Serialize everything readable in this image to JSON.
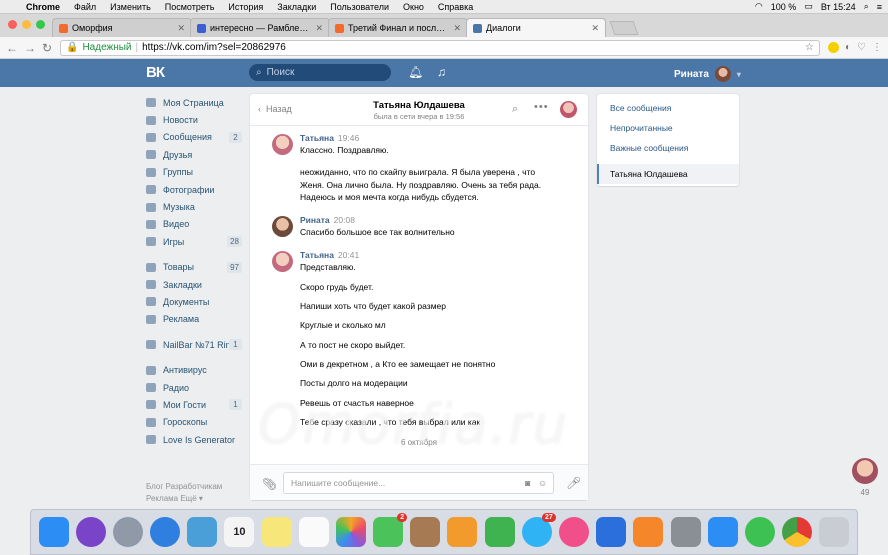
{
  "menubar": {
    "items": [
      "Chrome",
      "Файл",
      "Изменить",
      "Посмотреть",
      "История",
      "Закладки",
      "Пользователи",
      "Окно",
      "Справка"
    ],
    "battery": "100 %",
    "clock": "Вт 15:24"
  },
  "browser": {
    "tabs": [
      {
        "title": "Оморфия",
        "color": "#f26b2c"
      },
      {
        "title": "интересно — Рамблер/почта",
        "color": "#3b5fd1"
      },
      {
        "title": "Третий Финал и последний -",
        "color": "#f26b2c"
      },
      {
        "title": "Диалоги",
        "color": "#4a76a8"
      }
    ],
    "secure_label": "Надежный",
    "url": "https://vk.com/im?sel=20862976"
  },
  "vk": {
    "logo": "ВК",
    "search_placeholder": "Поиск",
    "user_name": "Рината",
    "sidebar": [
      {
        "label": "Моя Страница",
        "count": ""
      },
      {
        "label": "Новости",
        "count": ""
      },
      {
        "label": "Сообщения",
        "count": "2"
      },
      {
        "label": "Друзья",
        "count": ""
      },
      {
        "label": "Группы",
        "count": ""
      },
      {
        "label": "Фотографии",
        "count": ""
      },
      {
        "label": "Музыка",
        "count": ""
      },
      {
        "label": "Видео",
        "count": ""
      },
      {
        "label": "Игры",
        "count": "28"
      }
    ],
    "sidebar2": [
      {
        "label": "Товары",
        "count": "97"
      },
      {
        "label": "Закладки",
        "count": ""
      },
      {
        "label": "Документы",
        "count": ""
      },
      {
        "label": "Реклама",
        "count": ""
      }
    ],
    "sidebar3": [
      {
        "label": "NailBar №71 Rin…",
        "count": "1"
      }
    ],
    "sidebar4": [
      {
        "label": "Антивирус",
        "count": ""
      },
      {
        "label": "Радио",
        "count": ""
      },
      {
        "label": "Мои Гости",
        "count": "1"
      },
      {
        "label": "Гороскопы",
        "count": ""
      },
      {
        "label": "Love Is Generator",
        "count": ""
      }
    ],
    "footer": {
      "line1": "Блог  Разработчикам",
      "line2": "Реклама  Ещё ▾"
    },
    "chat": {
      "back": "Назад",
      "name": "Татьяна Юлдашева",
      "status": "была в сети вчера в 19:56",
      "messages": [
        {
          "author": "Татьяна",
          "time": "19:46",
          "lines": [
            "Классно. Поздравляю.",
            "",
            "неожиданно, что по скайпу выиграла. Я была уверена , что Женя. Она лично была. Ну поздравляю. Очень за тебя рада. Надеюсь и моя мечта когда нибудь сбудется."
          ]
        },
        {
          "author": "Рината",
          "time": "20:08",
          "lines": [
            "Спасибо большое все так волнительно"
          ]
        },
        {
          "author": "Татьяна",
          "time": "20:41",
          "lines": [
            "Представляю.",
            "",
            "Скоро грудь будет.",
            "",
            "Напиши хоть что будет какой размер",
            "",
            "Круглые и сколько мл",
            "",
            "А то пост не скоро выйдет.",
            "",
            "Оми в декретном , а Кто ее замещает не понятно",
            "",
            "Посты долго на модерации",
            "",
            "Ревешь от счастья наверное",
            "",
            "Тебе сразу сказали , что тебя выбрал или как"
          ]
        }
      ],
      "date_sep": "6 октября",
      "input_placeholder": "Напишите сообщение..."
    },
    "right_menu": [
      "Все сообщения",
      "Непрочитанные",
      "Важные сообщения"
    ],
    "right_active": "Татьяна Юлдашева",
    "widget_count": "49"
  },
  "watermark": "Omorfia.ru",
  "dock": [
    {
      "name": "finder",
      "color": "#2c8ef5",
      "badge": ""
    },
    {
      "name": "siri",
      "color": "#7a44c8",
      "badge": ""
    },
    {
      "name": "launchpad",
      "color": "#8f99a8",
      "badge": ""
    },
    {
      "name": "safari",
      "color": "#2f7fe0",
      "badge": ""
    },
    {
      "name": "photo-viewer",
      "color": "#4a9fd8",
      "badge": ""
    },
    {
      "name": "calendar",
      "color": "#f4f4f4",
      "badge": "",
      "text": "10"
    },
    {
      "name": "notes",
      "color": "#f7e67a",
      "badge": ""
    },
    {
      "name": "reminders",
      "color": "#fafafa",
      "badge": ""
    },
    {
      "name": "photos",
      "color": "#ffffff",
      "badge": ""
    },
    {
      "name": "facetime",
      "color": "#4cc35a",
      "badge": "2"
    },
    {
      "name": "contacts",
      "color": "#a67a52",
      "badge": ""
    },
    {
      "name": "pages",
      "color": "#f29b2c",
      "badge": ""
    },
    {
      "name": "numbers",
      "color": "#3fb34f",
      "badge": ""
    },
    {
      "name": "messages",
      "color": "#2fb3f5",
      "badge": "27"
    },
    {
      "name": "itunes",
      "color": "#f04f8a",
      "badge": ""
    },
    {
      "name": "keynote",
      "color": "#2a6fdb",
      "badge": ""
    },
    {
      "name": "ibooks",
      "color": "#f5862a",
      "badge": ""
    },
    {
      "name": "system-preferences",
      "color": "#8a8f96",
      "badge": ""
    },
    {
      "name": "app-store",
      "color": "#2c8ef5",
      "badge": ""
    },
    {
      "name": "whatsapp",
      "color": "#3cc152",
      "badge": ""
    },
    {
      "name": "chrome",
      "color": "#e3e3e3",
      "badge": ""
    },
    {
      "name": "trash",
      "color": "#c9cdd3",
      "badge": ""
    }
  ]
}
